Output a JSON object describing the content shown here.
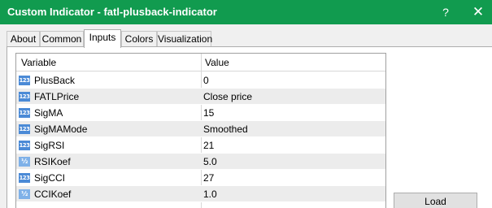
{
  "window": {
    "title": "Custom Indicator - fatl-plusback-indicator",
    "help_glyph": "?",
    "close_glyph": "✕"
  },
  "tabs": [
    {
      "label": "About"
    },
    {
      "label": "Common"
    },
    {
      "label": "Inputs",
      "active": true
    },
    {
      "label": "Colors"
    },
    {
      "label": "Visualization"
    }
  ],
  "inputs": {
    "headers": {
      "variable": "Variable",
      "value": "Value"
    },
    "rows": [
      {
        "icon": "int-icon",
        "icon_text": "123",
        "variable": "PlusBack",
        "value": "0"
      },
      {
        "icon": "int-icon",
        "icon_text": "123",
        "variable": "FATLPrice",
        "value": "Close price"
      },
      {
        "icon": "int-icon",
        "icon_text": "123",
        "variable": "SigMA",
        "value": "15"
      },
      {
        "icon": "int-icon",
        "icon_text": "123",
        "variable": "SigMAMode",
        "value": "Smoothed"
      },
      {
        "icon": "int-icon",
        "icon_text": "123",
        "variable": "SigRSI",
        "value": "21"
      },
      {
        "icon": "double-icon",
        "icon_text": "½",
        "variable": "RSIKoef",
        "value": "5.0"
      },
      {
        "icon": "int-icon",
        "icon_text": "123",
        "variable": "SigCCI",
        "value": "27"
      },
      {
        "icon": "double-icon",
        "icon_text": "½",
        "variable": "CCIKoef",
        "value": "1.0"
      }
    ]
  },
  "buttons": {
    "load_label": "Load"
  },
  "colors": {
    "titlebar": "#119b4f",
    "int_icon": "#4b8ad6",
    "double_icon": "#7fb1e8",
    "row_alt": "#ececec"
  }
}
